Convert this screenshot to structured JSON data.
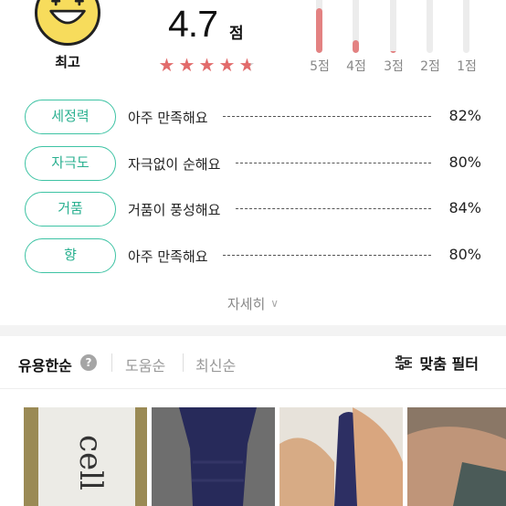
{
  "rating": {
    "face_label": "최고",
    "score": "4.7",
    "score_unit": "점",
    "stars": {
      "full": 4,
      "partial_fraction": 0.7
    },
    "distribution": [
      {
        "label": "5점",
        "fraction": 0.85
      },
      {
        "label": "4점",
        "fraction": 0.25
      },
      {
        "label": "3점",
        "fraction": 0.03
      },
      {
        "label": "2점",
        "fraction": 0.0
      },
      {
        "label": "1점",
        "fraction": 0.0
      }
    ]
  },
  "attributes": [
    {
      "name": "세정력",
      "value": "아주 만족해요",
      "percent": "82%"
    },
    {
      "name": "자극도",
      "value": "자극없이 순해요",
      "percent": "80%"
    },
    {
      "name": "거품",
      "value": "거품이 풍성해요",
      "percent": "84%"
    },
    {
      "name": "향",
      "value": "아주 만족해요",
      "percent": "80%"
    }
  ],
  "more_label": "자세히",
  "sort": {
    "active": "유용한순",
    "help": "?",
    "options": [
      "도움순",
      "최신순"
    ],
    "filter_label": "맞춤 필터"
  },
  "thumb_text": "cell",
  "colors": {
    "accent": "#3ec3a4",
    "star": "#e26b6b",
    "bar": "#e38282",
    "face": "#f7dc5c"
  }
}
